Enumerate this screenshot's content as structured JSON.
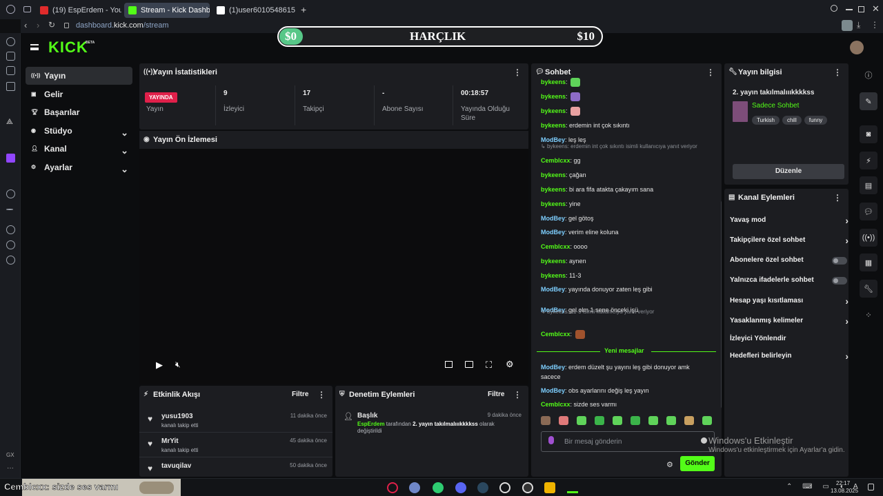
{
  "browser": {
    "tabs": [
      {
        "label": "(19) EspErdem - YouTube",
        "active": false,
        "fav_color": "#e02b2b"
      },
      {
        "label": "Stream - Kick Dashboard",
        "active": true,
        "fav_color": "#53fc18"
      },
      {
        "label": "(1)user6010548615054 (@",
        "active": false,
        "fav_color": "#ffffff"
      }
    ],
    "url_prefix": "dashboard.",
    "url_host": "kick.com",
    "url_path": "/stream"
  },
  "overlay": {
    "left": "$0",
    "title": "HARÇLIK",
    "right": "$10"
  },
  "sidebar": {
    "logo": "KICK",
    "beta": "BETA",
    "items": [
      {
        "label": "Yayın",
        "icon": "broadcast-icon",
        "active": true,
        "expand": false
      },
      {
        "label": "Gelir",
        "icon": "dollar-icon",
        "active": false,
        "expand": false
      },
      {
        "label": "Başarılar",
        "icon": "trophy-icon",
        "active": false,
        "expand": false
      },
      {
        "label": "Stüdyo",
        "icon": "camera-icon",
        "active": false,
        "expand": true
      },
      {
        "label": "Kanal",
        "icon": "user-icon",
        "active": false,
        "expand": true
      },
      {
        "label": "Ayarlar",
        "icon": "gear-icon",
        "active": false,
        "expand": true
      }
    ]
  },
  "stats": {
    "title": "Yayın İstatistikleri",
    "live_badge": "YAYINDA",
    "live_label": "Yayın",
    "viewers_value": "9",
    "viewers_label": "İzleyici",
    "followers_value": "17",
    "followers_label": "Takipçi",
    "subs_value": "-",
    "subs_label": "Abone Sayısı",
    "time_value": "00:18:57",
    "time_label": "Yayında Olduğu Süre"
  },
  "preview": {
    "title": "Yayın Ön İzlemesi"
  },
  "activity": {
    "title": "Etkinlik Akışı",
    "filter": "Filtre",
    "rows": [
      {
        "name": "yusu1903",
        "sub": "kanalı takip etti",
        "time": "11 dakika önce"
      },
      {
        "name": "MrYit",
        "sub": "kanalı takip etti",
        "time": "45 dakika önce"
      },
      {
        "name": "tavuqilav",
        "sub": "",
        "time": "50 dakika önce"
      }
    ]
  },
  "moderation": {
    "title": "Denetim Eylemleri",
    "filter": "Filtre",
    "item_title": "Başlık",
    "item_time": "9 dakika önce",
    "item_user": "EspErdem",
    "item_by": " tarafından ",
    "item_value": "2. yayın takılmalıııkkkkss",
    "item_suffix": " olarak",
    "item_line2": "değiştirildi"
  },
  "chat": {
    "title": "Sohbet",
    "messages": [
      {
        "user": "bykeens",
        "text": "",
        "color": "#53fc18",
        "emote": "#5fd35a"
      },
      {
        "user": "bykeens",
        "text": "",
        "color": "#53fc18",
        "emote": "#8e6cc8"
      },
      {
        "user": "bykeens",
        "text": "",
        "color": "#53fc18",
        "emote": "#e8a1a1"
      },
      {
        "user": "bykeens",
        "text": "erdemin int çok sıkıntı",
        "color": "#53fc18",
        "emote": ""
      },
      {
        "user": "ModBey",
        "text": "leş leş",
        "color": "#7ecfff",
        "emote": ""
      },
      {
        "user": "Cemblcxx",
        "text": "gg",
        "color": "#53fc18",
        "emote": ""
      },
      {
        "user": "bykeens",
        "text": "çağan",
        "color": "#53fc18",
        "emote": ""
      },
      {
        "user": "bykeens",
        "text": "bi ara fifa atakta çakayım sana",
        "color": "#53fc18",
        "emote": ""
      },
      {
        "user": "bykeens",
        "text": "yine",
        "color": "#53fc18",
        "emote": ""
      },
      {
        "user": "ModBey",
        "text": "gel götoş",
        "color": "#7ecfff",
        "emote": ""
      },
      {
        "user": "ModBey",
        "text": "verim eline koluna",
        "color": "#7ecfff",
        "emote": ""
      },
      {
        "user": "Cemblcxx",
        "text": "oooo",
        "color": "#53fc18",
        "emote": ""
      },
      {
        "user": "bykeens",
        "text": "aynen",
        "color": "#53fc18",
        "emote": ""
      },
      {
        "user": "bykeens",
        "text": "11-3",
        "color": "#53fc18",
        "emote": ""
      },
      {
        "user": "ModBey",
        "text": "yayında donuyor zaten leş gibi",
        "color": "#7ecfff",
        "emote": ""
      },
      {
        "user": "ModBey",
        "text": "gel olm 1 sene önceki işü",
        "color": "#7ecfff",
        "emote": ""
      },
      {
        "user": "Cemblcxx",
        "text": "",
        "color": "#53fc18",
        "emote": "#a0522d"
      }
    ],
    "reply1": "bykeens: erdemin int çok sıkıntı isimli kullanıcıya yanıt veriyor",
    "reply2": "bykeens: 11-3 isimli kullanıcıya yanıt veriyor",
    "new_messages": "Yeni mesajlar",
    "new": [
      {
        "user": "ModBey",
        "text": "erdem düzelt şu yayını leş gibi donuyor amk",
        "cont": "sacece",
        "color": "#7ecfff"
      },
      {
        "user": "ModBey",
        "text": "obs ayarlarını değiş leş yayın",
        "cont": "",
        "color": "#7ecfff"
      },
      {
        "user": "Cemblcxx",
        "text": "sizde ses varmı",
        "cont": "",
        "color": "#53fc18"
      }
    ],
    "placeholder": "Bir mesaj gönderin",
    "send": "Gönder"
  },
  "stream_info": {
    "title": "Yayın bilgisi",
    "stream_title": "2. yayın takılmalıııkkkkss",
    "category": "Sadece Sohbet",
    "tags": [
      "Turkish",
      "chill",
      "funny"
    ],
    "edit": "Düzenle"
  },
  "channel_actions": {
    "title": "Kanal Eylemleri",
    "rows": [
      {
        "label": "Yavaş mod",
        "kind": "arrow"
      },
      {
        "label": "Takipçilere özel sohbet",
        "kind": "arrow"
      },
      {
        "label": "Abonelere özel sohbet",
        "kind": "toggle"
      },
      {
        "label": "Yalnızca ifadelerle sohbet",
        "kind": "toggle"
      },
      {
        "label": "Hesap yaşı kısıtlaması",
        "kind": "arrow"
      },
      {
        "label": "Yasaklanmış kelimeler",
        "kind": "arrow"
      },
      {
        "label": "İzleyici Yönlendir",
        "kind": "none"
      },
      {
        "label": "Hedefleri belirleyin",
        "kind": "arrow"
      }
    ]
  },
  "windows": {
    "activate_title": "Windows'u Etkinleştir",
    "activate_sub": "Windows'u etkinleştirmek için Ayarlar'a gidin.",
    "clock_time": "22:17",
    "clock_date": "13.08.2025",
    "preview_text": "Cemblcxx: sizde ses varmı",
    "gx": "GX"
  },
  "colors": {
    "accent": "#53fc18",
    "live": "#e0204a",
    "panel": "#1c1d21"
  }
}
